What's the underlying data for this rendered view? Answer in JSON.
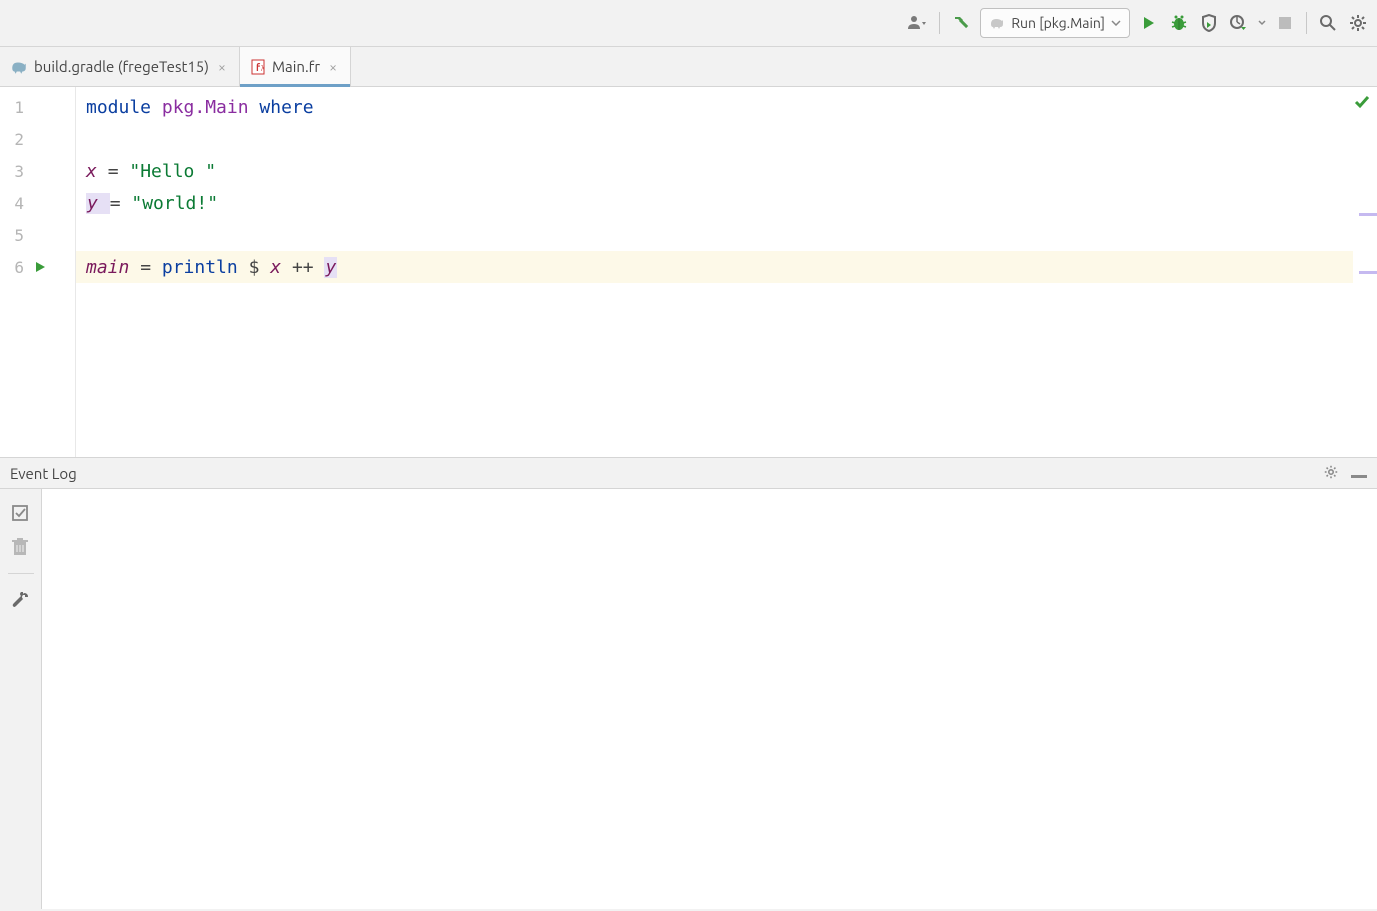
{
  "toolbar": {
    "run_config_label": "Run [pkg.Main]"
  },
  "tabs": [
    {
      "label": "build.gradle (fregeTest15)",
      "icon": "elephant",
      "active": false
    },
    {
      "label": "Main.fr",
      "icon": "frege",
      "active": true
    }
  ],
  "editor": {
    "lines": [
      {
        "num": "1",
        "tokens": [
          {
            "t": "module ",
            "c": "kw"
          },
          {
            "t": "pkg.Main ",
            "c": "pkg"
          },
          {
            "t": "where",
            "c": "kw"
          }
        ]
      },
      {
        "num": "2",
        "tokens": []
      },
      {
        "num": "3",
        "tokens": [
          {
            "t": "x ",
            "c": "ident"
          },
          {
            "t": "= ",
            "c": "op"
          },
          {
            "t": "\"Hello \"",
            "c": "str"
          }
        ]
      },
      {
        "num": "4",
        "tokens": [
          {
            "t": "y ",
            "c": "ident",
            "hl": true
          },
          {
            "t": "= ",
            "c": "op"
          },
          {
            "t": "\"world!\"",
            "c": "str"
          }
        ]
      },
      {
        "num": "5",
        "tokens": []
      },
      {
        "num": "6",
        "run_icon": true,
        "current": true,
        "tokens": [
          {
            "t": "main ",
            "c": "ident"
          },
          {
            "t": "= ",
            "c": "op"
          },
          {
            "t": "println ",
            "c": "kw"
          },
          {
            "t": "$ ",
            "c": "dollar-op"
          },
          {
            "t": "x ",
            "c": "ident"
          },
          {
            "t": "++ ",
            "c": "op"
          },
          {
            "t": "y",
            "c": "ident",
            "hl": true
          }
        ]
      }
    ]
  },
  "event_log": {
    "title": "Event Log"
  }
}
